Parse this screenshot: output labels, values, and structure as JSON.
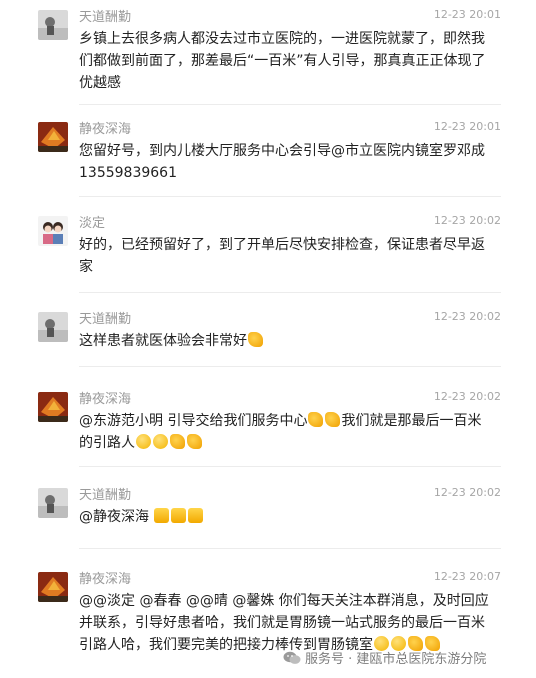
{
  "messages": [
    {
      "name": "天道酬勤",
      "time": "12-23 20:01",
      "text": "乡镇上去很多病人都没去过市立医院的，一进医院就蒙了，即然我们都做到前面了，那差最后“一百米”有人引导，那真真正正体现了优越感",
      "avatar": "avatar-tiandao"
    },
    {
      "name": "静夜深海",
      "time": "12-23 20:01",
      "text": "您留好号，到内儿楼大厅服务中心会引导@市立医院内镜室罗邓成13559839661",
      "avatar": "avatar-jingye"
    },
    {
      "name": "淡定",
      "time": "12-23 20:02",
      "text": "好的，已经预留好了，到了开单后尽快安排检查，保证患者尽早返家",
      "avatar": "avatar-danding"
    },
    {
      "name": "天道酬勤",
      "time": "12-23 20:02",
      "text": "这样患者就医体验会非常好",
      "emojis_after": [
        "pray"
      ],
      "avatar": "avatar-tiandao"
    },
    {
      "name": "静夜深海",
      "time": "12-23 20:02",
      "text_a": "@东游范小明 引导交给我们服务中心",
      "emojis_a": [
        "pray",
        "pray"
      ],
      "text_b": "我们就是那最后一百米的引路人",
      "emojis_b": [
        "face",
        "face",
        "pray",
        "pray"
      ],
      "avatar": "avatar-jingye"
    },
    {
      "name": "天道酬勤",
      "time": "12-23 20:02",
      "text": "@静夜深海 ",
      "emojis_after": [
        "thumb",
        "thumb",
        "thumb"
      ],
      "avatar": "avatar-tiandao"
    },
    {
      "name": "静夜深海",
      "time": "12-23 20:07",
      "text": "@@淡定 @春春 @@晴 @馨姝 你们每天关注本群消息，及时回应并联系，引导好患者哈，我们就是胃肠镜一站式服务的最后一百米引路人哈，我们要完美的把接力棒传到胃肠镜室",
      "emojis_after": [
        "face",
        "face",
        "pray",
        "pray"
      ],
      "avatar": "avatar-jingye"
    }
  ],
  "watermark": {
    "text": "服务号 · 建瓯市总医院东游分院",
    "icon": "wechat-icon"
  }
}
